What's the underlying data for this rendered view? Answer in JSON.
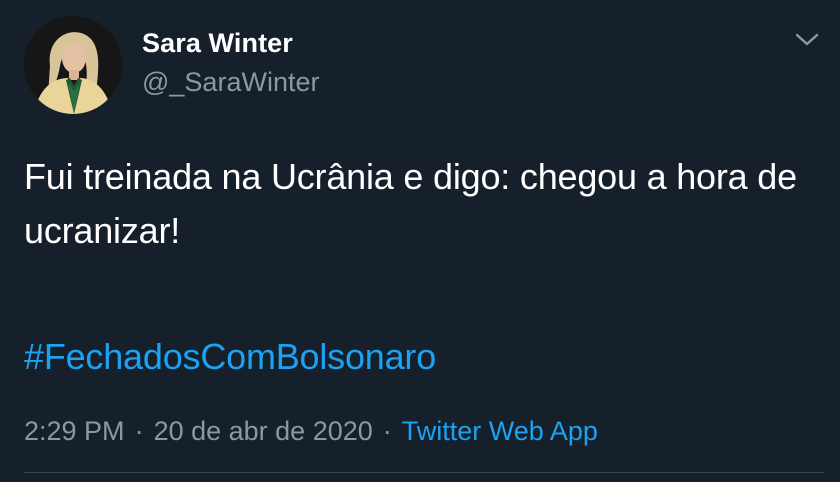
{
  "tweet": {
    "author": {
      "name": "Sara Winter",
      "handle": "@_SaraWinter"
    },
    "text": "Fui treinada na Ucrânia e digo: chegou a hora de ucranizar!",
    "hashtag": "#FechadosComBolsonaro",
    "time": "2:29 PM",
    "separator": "·",
    "date": "20 de abr de 2020",
    "source": "Twitter Web App"
  },
  "colors": {
    "background": "#15202b",
    "text": "#ffffff",
    "secondary_text": "#8899a6",
    "link": "#1da1f2",
    "divider": "#38444d"
  },
  "icons": {
    "menu": "chevron-down-icon",
    "avatar": "profile-photo"
  }
}
